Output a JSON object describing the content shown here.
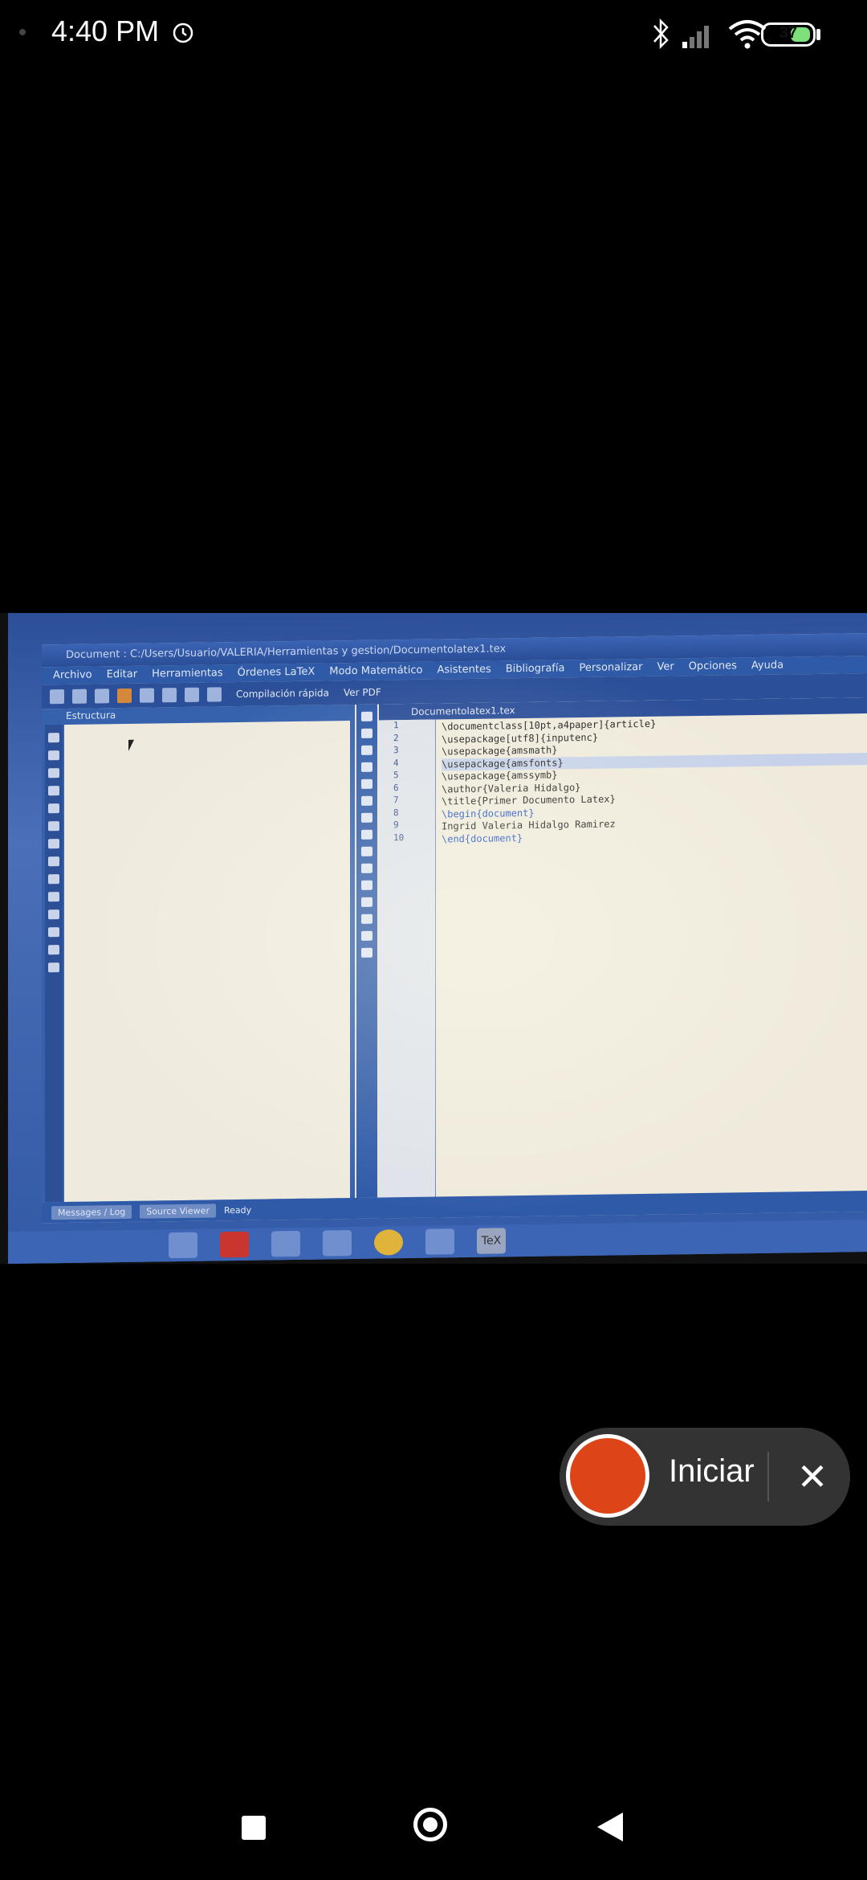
{
  "status_bar": {
    "time": "4:40 PM",
    "battery": "37"
  },
  "window": {
    "title": "Document : C:/Users/Usuario/VALERIA/Herramientas y gestion/Documentolatex1.tex",
    "menu": [
      "Archivo",
      "Editar",
      "Herramientas",
      "Órdenes LaTeX",
      "Modo Matemático",
      "Asistentes",
      "Bibliografía",
      "Personalizar",
      "Ver",
      "Opciones",
      "Ayuda"
    ],
    "toolbar": {
      "compile_label": "Compilación rápida",
      "view_label": "Ver PDF"
    },
    "structure_title": "Estructura",
    "editor_tab": "Documentolatex1.tex",
    "line_numbers": [
      "1",
      "2",
      "3",
      "4",
      "5",
      "6",
      "7",
      "8",
      "9",
      "10"
    ],
    "code_lines": [
      "\\documentclass[10pt,a4paper]{article}",
      "\\usepackage[utf8]{inputenc}",
      "\\usepackage{amsmath}",
      "\\usepackage{amsfonts}",
      "\\usepackage{amssymb}",
      "\\author{Valeria Hidalgo}",
      "\\title{Primer Documento Latex}",
      "\\begin{document}",
      "Ingrid Valeria Hidalgo Ramirez",
      "\\end{document}"
    ],
    "status": {
      "tab_messages": "Messages / Log",
      "tab_source": "Source Viewer",
      "ready": "Ready"
    },
    "taskbar_tex": "TeX"
  },
  "recorder": {
    "label": "Iniciar",
    "close": "✕",
    "colors": {
      "record": "#dd4518"
    }
  }
}
